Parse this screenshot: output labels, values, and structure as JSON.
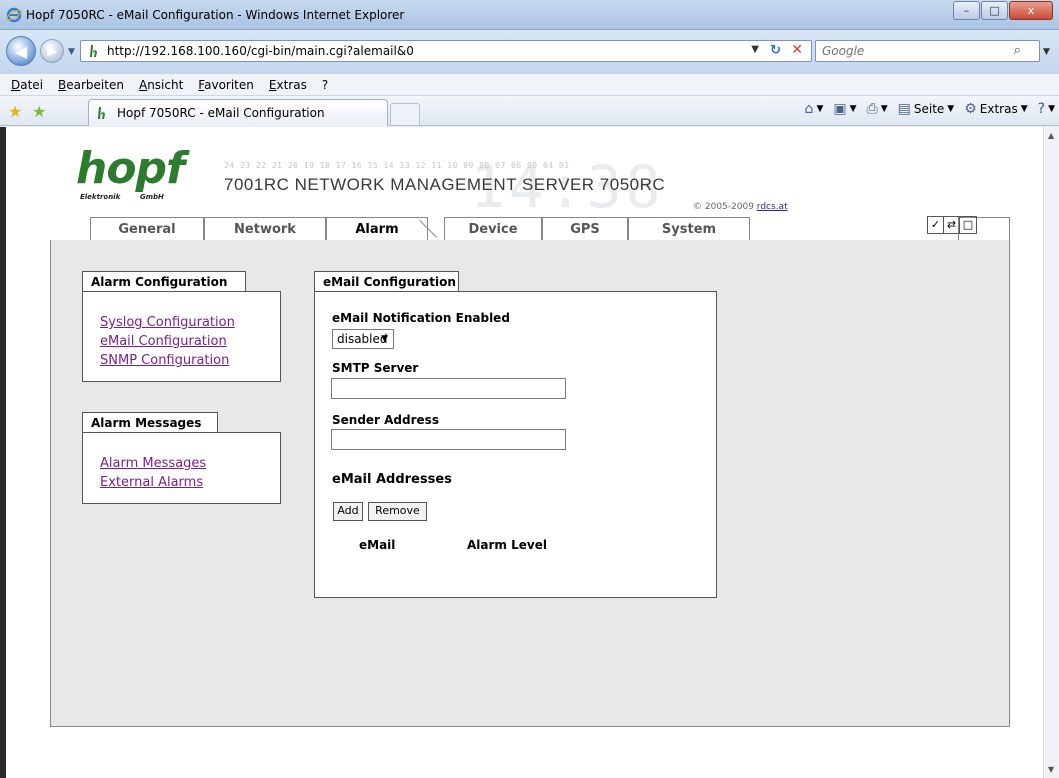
{
  "browser": {
    "window_title": "Hopf 7050RC - eMail Configuration - Windows Internet Explorer",
    "url": "http://192.168.100.160/cgi-bin/main.cgi?alemail&0",
    "search_placeholder": "Google",
    "menu": [
      "Datei",
      "Bearbeiten",
      "Ansicht",
      "Favoriten",
      "Extras",
      "?"
    ],
    "tab_title": "Hopf 7050RC - eMail Configuration",
    "command_bar": {
      "page": "Seite",
      "tools": "Extras"
    },
    "window_buttons": {
      "minimize": "–",
      "maximize": "□",
      "close": "x"
    }
  },
  "header": {
    "logo_word": "hopf",
    "logo_sub_left": "Elektronik",
    "logo_sub_right": "GmbH",
    "led_numbers": "24 23 22 21 20 19 18 17 16 15 14 13 12 11 10 09 08 07 06 05 04 01",
    "title": "7001RC NETWORK MANAGEMENT SERVER 7050RC",
    "copyright_prefix": "© 2005-2009",
    "copyright_link": "rdcs.at",
    "watermark": "14:38"
  },
  "nav_tabs": [
    {
      "label": "General",
      "active": false
    },
    {
      "label": "Network",
      "active": false
    },
    {
      "label": "Alarm",
      "active": true
    },
    {
      "label": "Device",
      "active": false
    },
    {
      "label": "GPS",
      "active": false
    },
    {
      "label": "System",
      "active": false
    }
  ],
  "tab_tools": [
    "✓",
    "⇄",
    "□"
  ],
  "sidebar": {
    "alarm_config": {
      "title": "Alarm Configuration",
      "links": [
        "Syslog Configuration",
        "eMail Configuration",
        "SNMP Configuration"
      ]
    },
    "alarm_messages": {
      "title": "Alarm Messages",
      "links": [
        "Alarm Messages",
        "External Alarms"
      ]
    }
  },
  "email_config": {
    "title": "eMail Configuration",
    "notification_label": "eMail Notification Enabled",
    "notification_value": "disabled",
    "smtp_label": "SMTP Server",
    "smtp_value": "",
    "sender_label": "Sender Address",
    "sender_value": "",
    "addresses_label": "eMail Addresses",
    "add_button": "Add",
    "remove_button": "Remove",
    "col_email": "eMail",
    "col_alarm_level": "Alarm Level"
  }
}
